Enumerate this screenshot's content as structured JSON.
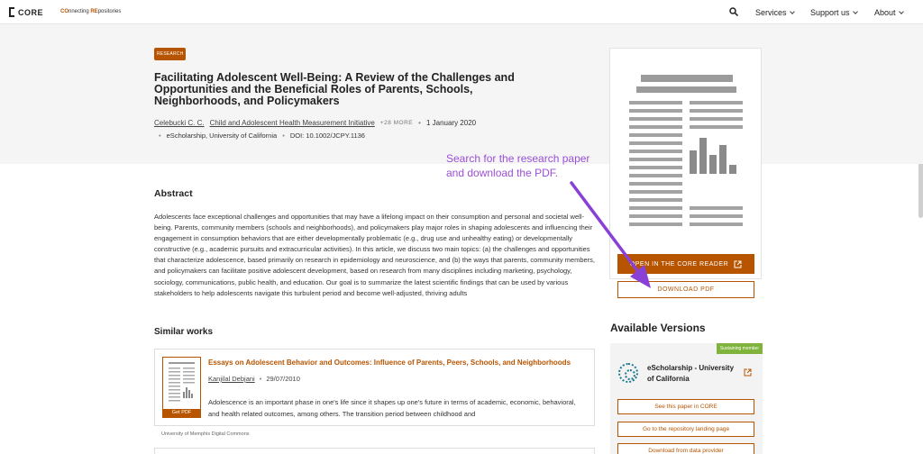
{
  "header": {
    "logo_text": "CORE",
    "tagline_parts": [
      "CO",
      "nnecting ",
      "RE",
      "positories"
    ],
    "nav": [
      {
        "label": "Services"
      },
      {
        "label": "Support us"
      },
      {
        "label": "About"
      }
    ],
    "icons": {
      "search": "search-icon"
    }
  },
  "paper": {
    "badge": "RESEARCH",
    "title": "Facilitating Adolescent Well-Being: A Review of the Challenges and Opportunities and the Beneficial Roles of Parents, Schools, Neighborhoods, and Policymakers",
    "author": "Celebucki C. C.",
    "coauthor": "Child and Adolescent Health Measurement Initiative",
    "more_authors": "+28 MORE",
    "date": "1 January 2020",
    "publisher": "eScholarship, University of California",
    "doi": "DOI: 10.1002/JCPY.1136"
  },
  "annotation": {
    "line1": "Search for the research paper",
    "line2": "and download the PDF."
  },
  "abstract": {
    "heading": "Abstract",
    "text": "Adolescents face exceptional challenges and opportunities that may have a lifelong impact on their consumption and personal and societal well-being. Parents, community members (schools and neighborhoods), and policymakers play major roles in shaping adolescents and influencing their engagement in consumption behaviors that are either developmentally problematic (e.g., drug use and unhealthy eating) or developmentally constructive (e.g., academic pursuits and extracurricular activities). In this article, we discuss two main topics: (a) the challenges and opportunities that characterize adolescence, based primarily on research in epidemiology and neuroscience, and (b) the ways that parents, community members, and policymakers can facilitate positive adolescent development, based on research from many disciplines including marketing, psychology, sociology, communications, public health, and education. Our goal is to summarize the latest scientific findings that can be used by various stakeholders to help adolescents navigate this turbulent period and become well-adjusted, thriving adults"
  },
  "similar": {
    "heading": "Similar works",
    "items": [
      {
        "title": "Essays on Adolescent Behavior and Outcomes: Influence of Parents, Peers, Schools, and Neighborhoods",
        "author": "Kanjilal Debjani",
        "date": "29/07/2010",
        "description": "Adolescence is an important phase in one's life since it shapes up one's future in terms of academic, economic, behavioral, and health related outcomes, among others. The transition period between childhood and",
        "thumb_label": "Get PDF",
        "source": "University of Memphis Digital Commons"
      }
    ]
  },
  "sidebar": {
    "reader_button": "OPEN IN THE CORE READER",
    "download_button": "DOWNLOAD PDF",
    "versions_heading": "Available Versions",
    "version": {
      "badge": "Sustaining member",
      "repo_name": "eScholarship - University of California",
      "buttons": [
        "See this paper in CORE",
        "Go to the repository landing page",
        "Download from data provider"
      ]
    }
  },
  "colors": {
    "accent": "#b75400",
    "annotation": "#9b4fd8",
    "sustaining": "#7fb33b"
  }
}
